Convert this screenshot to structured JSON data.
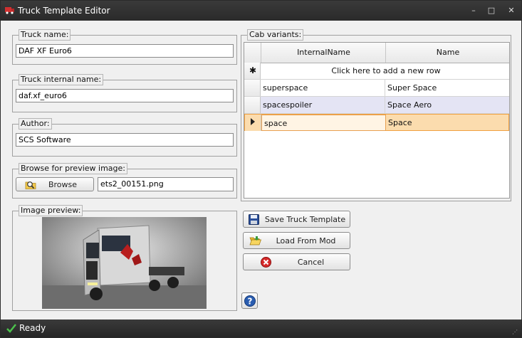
{
  "window": {
    "title": "Truck Template Editor"
  },
  "truck_name": {
    "label": "Truck name:",
    "value": "DAF XF Euro6"
  },
  "truck_internal_name": {
    "label": "Truck internal name:",
    "value": "daf.xf_euro6"
  },
  "author": {
    "label": "Author:",
    "value": "SCS Software"
  },
  "preview_browse": {
    "label": "Browse for preview image:",
    "button": "Browse",
    "file": "ets2_00151.png"
  },
  "image_preview": {
    "label": "Image preview:"
  },
  "cab_variants": {
    "label": "Cab variants:",
    "columns": [
      "InternalName",
      "Name"
    ],
    "new_row_text": "Click here to add a new row",
    "rows": [
      {
        "internal": "superspace",
        "name": "Super Space"
      },
      {
        "internal": "spacespoiler",
        "name": "Space Aero"
      },
      {
        "internal": "space",
        "name": "Space"
      }
    ]
  },
  "buttons": {
    "save": "Save Truck Template",
    "load": "Load From Mod",
    "cancel": "Cancel"
  },
  "status": {
    "text": "Ready"
  },
  "colors": {
    "accent_selected": "#fbdcae",
    "row_hover": "#e4e4f4",
    "titlebar": "#2f2f2f"
  }
}
